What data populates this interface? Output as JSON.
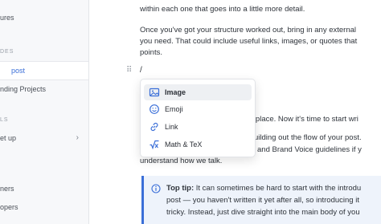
{
  "sidebar": {
    "item_top": "ures",
    "section_1": "DES",
    "active_item": "post",
    "item_2": "nding Projects",
    "section_2": "LS",
    "item_3": "et up",
    "item_3_chevron": "›",
    "item_4": "ners",
    "item_5": "opers"
  },
  "editor": {
    "line_1": "within each one that goes into a little more detail.",
    "line_2": "Once you've got your structure worked out, bring in any external",
    "line_3": "you need. That could include useful links, images, or quotes that",
    "line_4": "points.",
    "slash_text": "/",
    "drag_handle": "⠿",
    "line_5": "n place. Now it's time to start wri",
    "line_6": "uilding out the flow of your post.",
    "line_7": "and Brand Voice guidelines if y",
    "line_8": "understand how we talk."
  },
  "menu": {
    "items": [
      {
        "label": "Image",
        "icon": "image-icon"
      },
      {
        "label": "Emoji",
        "icon": "emoji-icon"
      },
      {
        "label": "Link",
        "icon": "link-icon"
      },
      {
        "label": "Math & TeX",
        "icon": "math-icon"
      }
    ]
  },
  "callout": {
    "label": "Top tip:",
    "line_1_rest": " It can sometimes be hard to start with the introdu",
    "line_2": "post — you haven't written it yet after all, so introducing it",
    "line_3": "tricky. Instead, just dive straight into the main body of you",
    "icon": "info-icon",
    "accent": "#3b6fd8"
  }
}
